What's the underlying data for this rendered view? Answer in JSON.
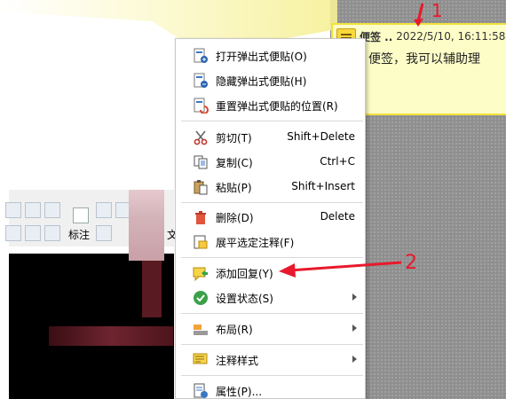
{
  "note": {
    "title": "便签 ..",
    "date": "2022/5/10, 16:11:58",
    "body": "便签，我可以辅助理"
  },
  "toolbar": {
    "markup_label": "标注",
    "text_label": "文"
  },
  "menu": {
    "items": [
      {
        "label": "打开弹出式便贴(O)",
        "shortcut": "",
        "icon": "open-note-icon"
      },
      {
        "label": "隐藏弹出式便贴(H)",
        "shortcut": "",
        "icon": "hide-note-icon"
      },
      {
        "label": "重置弹出式便贴的位置(R)",
        "shortcut": "",
        "icon": "reset-note-icon"
      },
      {
        "label": "剪切(T)",
        "shortcut": "Shift+Delete",
        "icon": "scissors-icon"
      },
      {
        "label": "复制(C)",
        "shortcut": "Ctrl+C",
        "icon": "copy-icon"
      },
      {
        "label": "粘贴(P)",
        "shortcut": "Shift+Insert",
        "icon": "paste-icon"
      },
      {
        "label": "删除(D)",
        "shortcut": "Delete",
        "icon": "trash-icon"
      },
      {
        "label": "展平选定注释(F)",
        "shortcut": "",
        "icon": "flatten-icon"
      },
      {
        "label": "添加回复(Y)",
        "shortcut": "",
        "icon": "reply-icon"
      },
      {
        "label": "设置状态(S)",
        "shortcut": "",
        "icon": "status-check-icon"
      },
      {
        "label": "布局(R)",
        "shortcut": "",
        "icon": "layout-icon"
      },
      {
        "label": "注释样式",
        "shortcut": "",
        "icon": "annotation-style-icon"
      },
      {
        "label": "属性(P)...",
        "shortcut": "",
        "icon": "properties-icon"
      }
    ]
  },
  "callouts": {
    "one": "1",
    "two": "2"
  },
  "colors": {
    "accent_red": "#e8192c",
    "note_bg": "#fcfdc7",
    "note_border": "#f2e23a"
  }
}
